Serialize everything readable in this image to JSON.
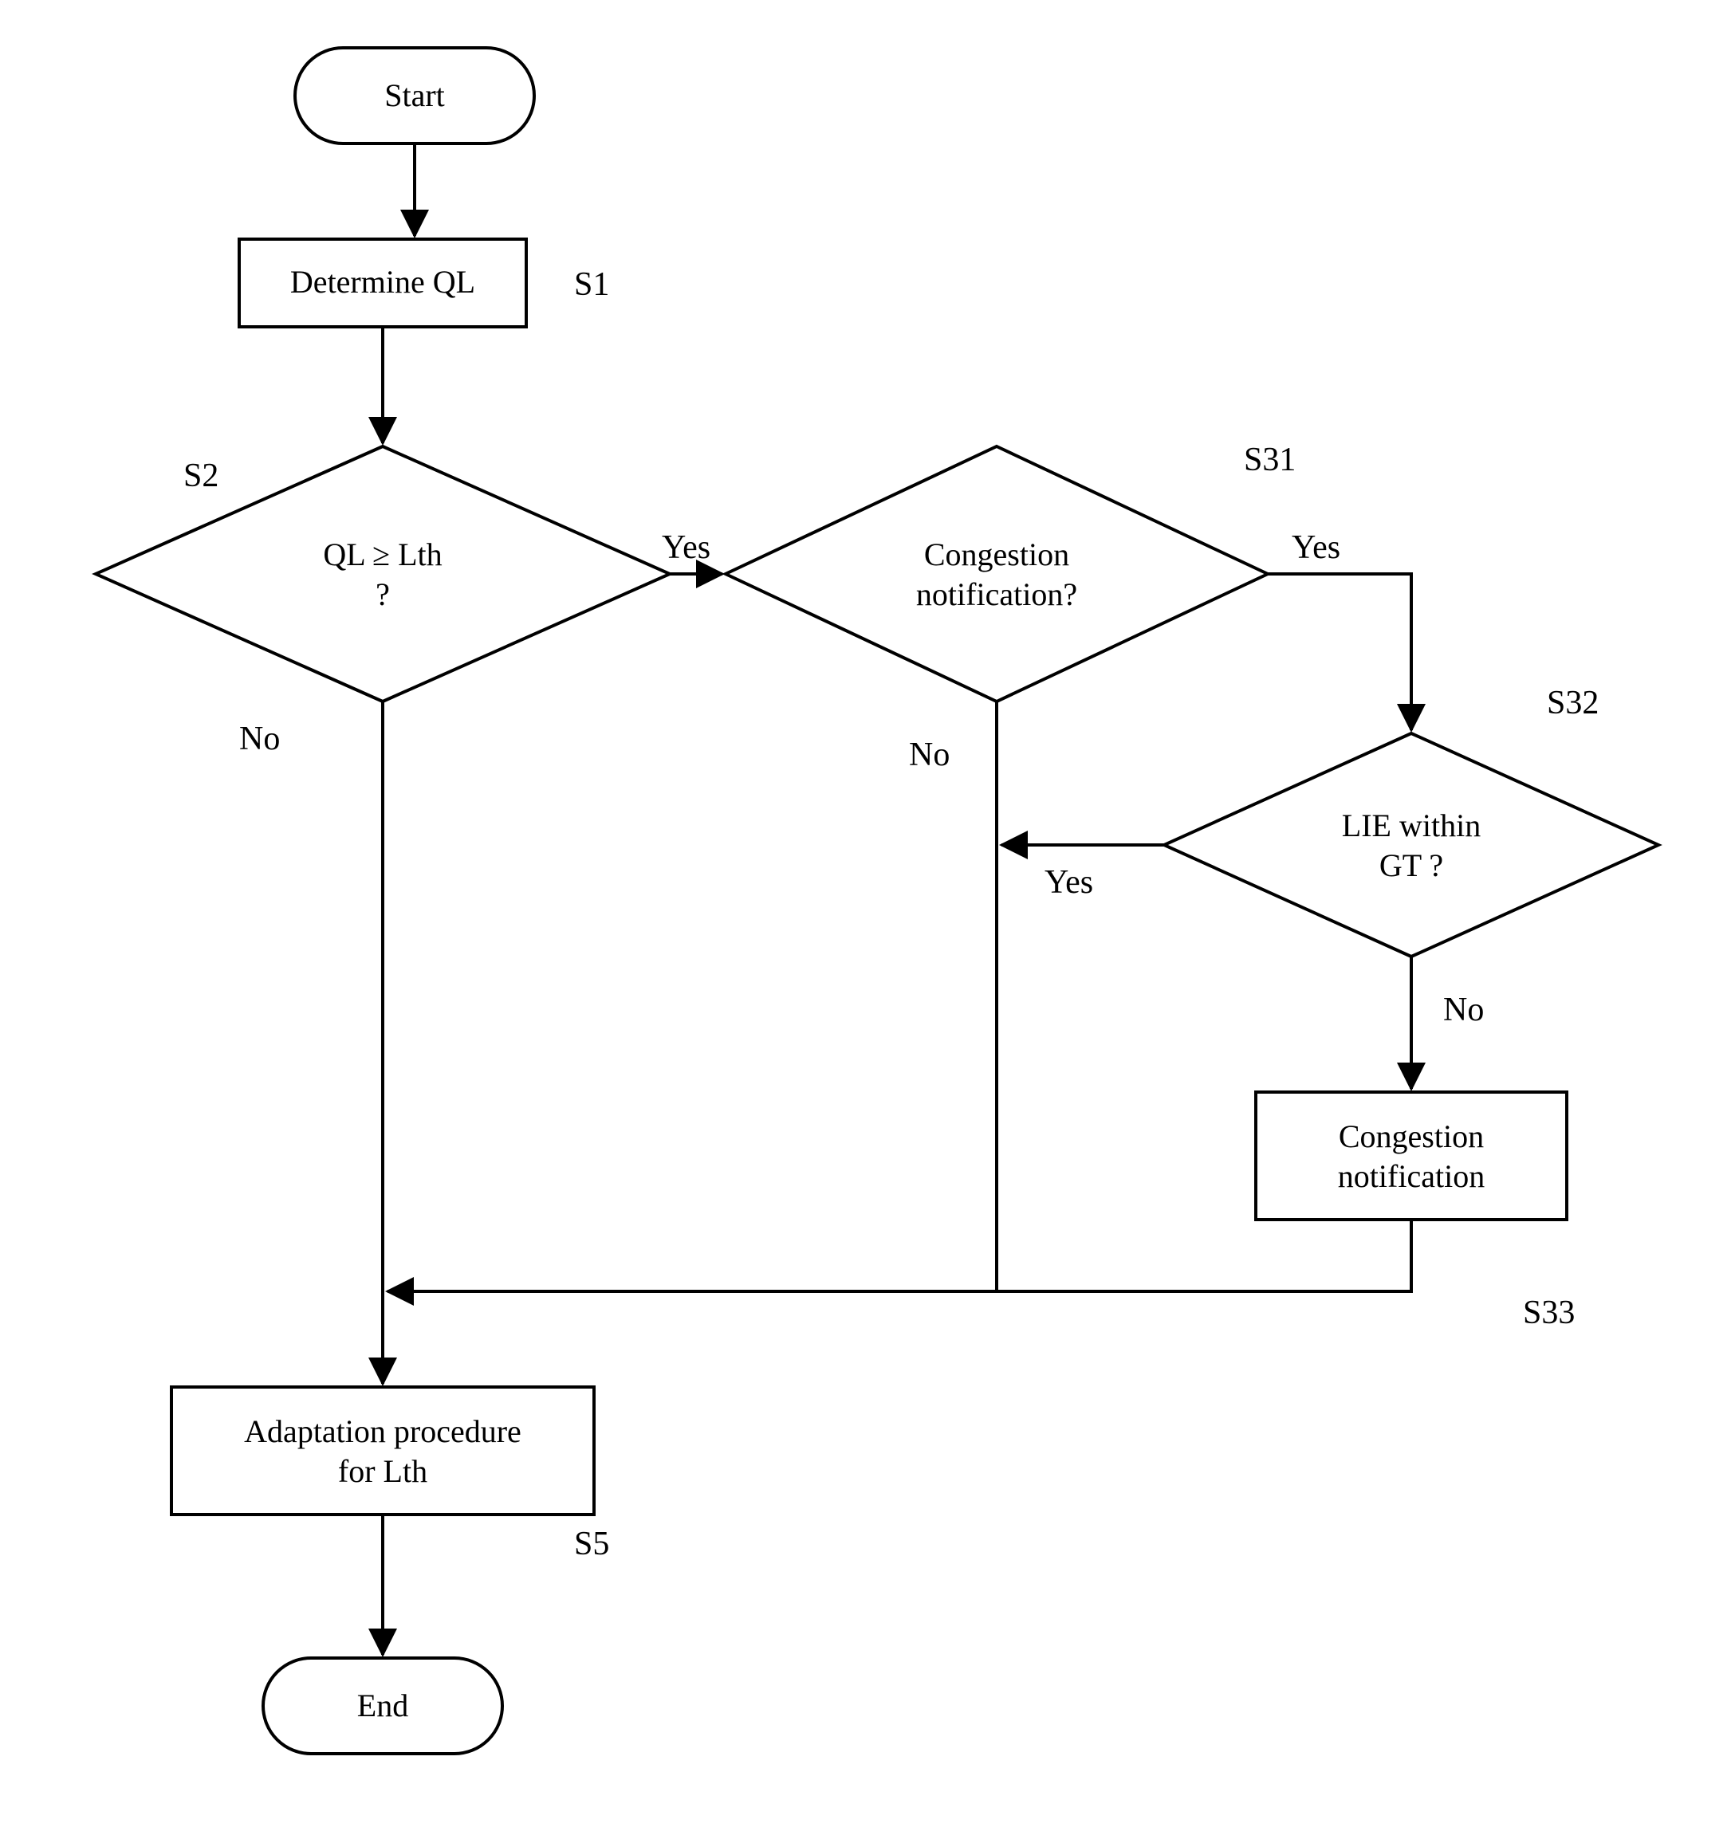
{
  "chart_data": {
    "type": "flowchart",
    "nodes": [
      {
        "id": "start",
        "shape": "terminator",
        "text": "Start"
      },
      {
        "id": "s1",
        "shape": "process",
        "text": "Determine QL",
        "label": "S1"
      },
      {
        "id": "s2",
        "shape": "decision",
        "text": "QL ≥ Lth\n?",
        "label": "S2"
      },
      {
        "id": "s31",
        "shape": "decision",
        "text": "Congestion\nnotification?",
        "label": "S31"
      },
      {
        "id": "s32",
        "shape": "decision",
        "text": "LIE within\nGT ?",
        "label": "S32"
      },
      {
        "id": "s33",
        "shape": "process",
        "text": "Congestion\nnotification",
        "label": "S33"
      },
      {
        "id": "s5",
        "shape": "process",
        "text": "Adaptation procedure\nfor Lth",
        "label": "S5"
      },
      {
        "id": "end",
        "shape": "terminator",
        "text": "End"
      }
    ],
    "edges": [
      {
        "from": "start",
        "to": "s1"
      },
      {
        "from": "s1",
        "to": "s2"
      },
      {
        "from": "s2",
        "to": "s31",
        "label": "Yes"
      },
      {
        "from": "s2",
        "to": "s5",
        "label": "No"
      },
      {
        "from": "s31",
        "to": "s32",
        "label": "Yes"
      },
      {
        "from": "s31",
        "to": "merge",
        "label": "No"
      },
      {
        "from": "s32",
        "to": "merge",
        "label": "Yes"
      },
      {
        "from": "s32",
        "to": "s33",
        "label": "No"
      },
      {
        "from": "s33",
        "to": "merge"
      },
      {
        "from": "merge",
        "to": "s5"
      },
      {
        "from": "s5",
        "to": "end"
      }
    ]
  },
  "nodes": {
    "start": "Start",
    "s1": "Determine QL",
    "s2_l1": "QL ≥ Lth",
    "s2_l2": "?",
    "s31_l1": "Congestion",
    "s31_l2": "notification?",
    "s32_l1": "LIE within",
    "s32_l2": "GT ?",
    "s33_l1": "Congestion",
    "s33_l2": "notification",
    "s5_l1": "Adaptation procedure",
    "s5_l2": "for Lth",
    "end": "End"
  },
  "labels": {
    "S1": "S1",
    "S2": "S2",
    "S31": "S31",
    "S32": "S32",
    "S33": "S33",
    "S5": "S5",
    "Yes": "Yes",
    "No": "No"
  }
}
